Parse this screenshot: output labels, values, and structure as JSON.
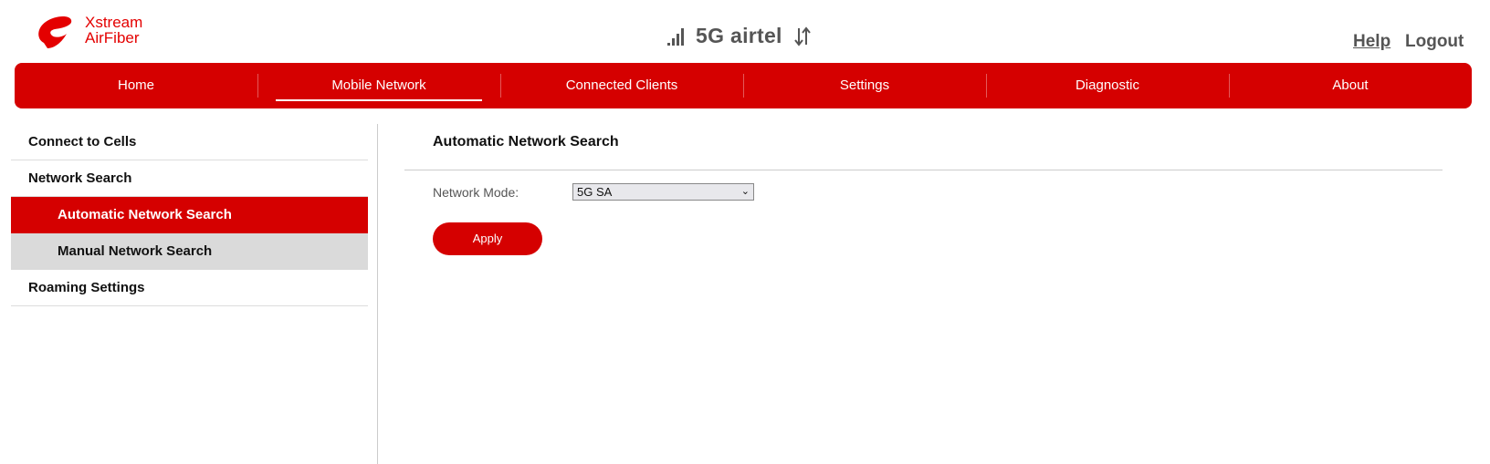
{
  "brand": {
    "line1": "Xstream",
    "line2": "AirFiber"
  },
  "status": {
    "carrier": "5G airtel",
    "signal_icon": "signal-bars-icon",
    "data_icon": "up-down-arrows-icon"
  },
  "header_links": {
    "help": "Help",
    "logout": "Logout"
  },
  "nav": {
    "items": [
      {
        "label": "Home"
      },
      {
        "label": "Mobile Network",
        "active": true
      },
      {
        "label": "Connected Clients"
      },
      {
        "label": "Settings"
      },
      {
        "label": "Diagnostic"
      },
      {
        "label": "About"
      }
    ]
  },
  "sidebar": {
    "items": [
      {
        "label": "Connect to Cells"
      },
      {
        "label": "Network Search"
      },
      {
        "label": "Automatic Network Search",
        "active": true
      },
      {
        "label": "Manual Network Search"
      },
      {
        "label": "Roaming Settings"
      }
    ]
  },
  "content": {
    "title": "Automatic Network Search",
    "network_mode_label": "Network Mode:",
    "network_mode_value": "5G SA",
    "apply_label": "Apply"
  },
  "colors": {
    "brand_red": "#d50000",
    "logo_red": "#e40000",
    "text_gray": "#555555"
  }
}
